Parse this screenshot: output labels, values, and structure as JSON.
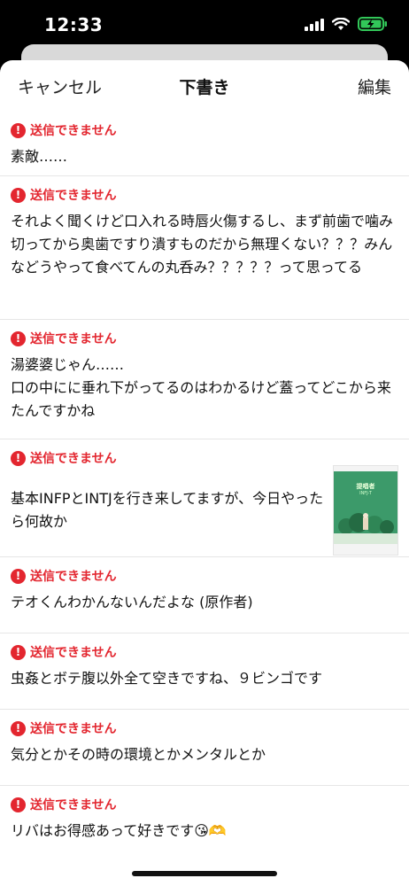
{
  "status_bar": {
    "time": "12:33",
    "icons": [
      "cellular-icon",
      "wifi-icon",
      "battery-charging-icon"
    ]
  },
  "nav": {
    "cancel": "キャンセル",
    "title": "下書き",
    "edit": "編集"
  },
  "error_label": "送信できません",
  "drafts": [
    {
      "text": "素敵……"
    },
    {
      "text": "それよく聞くけど口入れる時唇火傷するし、まず前歯で噛み切ってから奥歯ですり潰すものだから無理くない？？？みんなどうやって食べてんの丸呑み？？？？？って思ってる"
    },
    {
      "text": "湯婆婆じゃん……\n口の中にに垂れ下がってるのはわかるけど蓋ってどこから来たんですかね"
    },
    {
      "text": "基本INFPとINTJを行き来してますが、今日やったら何故か",
      "thumbnail": {
        "title": "提唱者",
        "subtitle": "INFJ-T"
      }
    },
    {
      "text": "テオくんわかんないんだよな (原作者)"
    },
    {
      "text": "虫姦とボテ腹以外全て空きですね、９ビンゴです"
    },
    {
      "text": "気分とかその時の環境とかメンタルとか"
    },
    {
      "text": "リバはお得感あって好きです😘🫶"
    }
  ],
  "colors": {
    "error": "#e3262f",
    "background": "#ffffff",
    "status_bar": "#000000"
  }
}
